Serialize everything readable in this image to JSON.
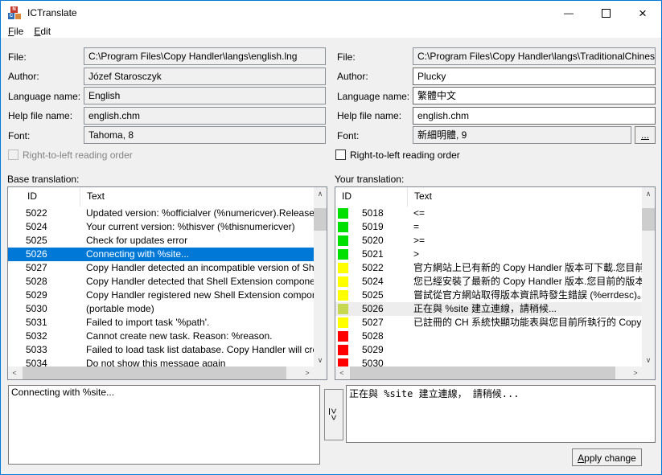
{
  "window": {
    "title": "ICTranslate",
    "icon_letters": [
      "N",
      "C"
    ],
    "controls": {
      "minimize": "—",
      "close": "×"
    }
  },
  "menu": {
    "file": {
      "accel": "F",
      "rest": "ile"
    },
    "edit": {
      "accel": "E",
      "rest": "dit"
    }
  },
  "left_panel": {
    "file_label": "File:",
    "file_value": "C:\\Program Files\\Copy Handler\\langs\\english.lng",
    "author_label": "Author:",
    "author_value": "Józef Starosczyk",
    "language_label": "Language name:",
    "language_value": "English",
    "helpfile_label": "Help file name:",
    "helpfile_value": "english.chm",
    "font_label": "Font:",
    "font_value": "Tahoma, 8",
    "rtl_label": "Right-to-left reading order"
  },
  "right_panel": {
    "file_label": "File:",
    "file_value": "C:\\Program Files\\Copy Handler\\langs\\TraditionalChinese.lng",
    "author_label": "Author:",
    "author_value": "Plucky",
    "language_label": "Language name:",
    "language_value": "繁體中文",
    "helpfile_label": "Help file name:",
    "helpfile_value": "english.chm",
    "font_label": "Font:",
    "font_value": "新細明體, 9",
    "font_button": "...",
    "rtl_label": "Right-to-left reading order"
  },
  "base_list": {
    "label": "Base translation:",
    "columns": [
      "ID",
      "Text"
    ],
    "rows": [
      {
        "id": "5022",
        "text": "Updated version: %officialver (%numericver).Released: %r"
      },
      {
        "id": "5024",
        "text": "Your current version: %thisver (%thisnumericver)"
      },
      {
        "id": "5025",
        "text": "Check for updates error"
      },
      {
        "id": "5026",
        "text": "Connecting with %site...",
        "selected": "active"
      },
      {
        "id": "5027",
        "text": "Copy Handler detected an incompatible version of Shell Exte"
      },
      {
        "id": "5028",
        "text": "Copy Handler detected that Shell Extension component is no"
      },
      {
        "id": "5029",
        "text": "Copy Handler registered new Shell Extension component, bu"
      },
      {
        "id": "5030",
        "text": " (portable mode)"
      },
      {
        "id": "5031",
        "text": "Failed to import task '%path'."
      },
      {
        "id": "5032",
        "text": "Cannot create new task. Reason: %reason."
      },
      {
        "id": "5033",
        "text": "Failed to load task list database. Copy Handler will create a r"
      },
      {
        "id": "5034",
        "text": "Do not show this message again"
      }
    ]
  },
  "your_list": {
    "label": "Your translation:",
    "columns": [
      "ID",
      "Text"
    ],
    "rows": [
      {
        "id": "5018",
        "text": "<=",
        "status_color": "#00e000"
      },
      {
        "id": "5019",
        "text": "=",
        "status_color": "#00e000"
      },
      {
        "id": "5020",
        "text": ">=",
        "status_color": "#00e000"
      },
      {
        "id": "5021",
        "text": ">",
        "status_color": "#00e000"
      },
      {
        "id": "5022",
        "text": "官方網站上已有新的 Copy Handler 版本可下載.您目前的",
        "status_color": "#ffff00"
      },
      {
        "id": "5024",
        "text": "您已經安裝了最新的 Copy Handler 版本.您目前的版本: .",
        "status_color": "#ffff00"
      },
      {
        "id": "5025",
        "text": "嘗試從官方網站取得版本資訊時發生錯誤 (%errdesc)。",
        "status_color": "#ffff00"
      },
      {
        "id": "5026",
        "text": "正在與 %site 建立連線，請稍候...",
        "status_color": "#c6d84f",
        "selected": "inactive"
      },
      {
        "id": "5027",
        "text": "已註冊的 CH 系統快顯功能表與您目前所執行的 Copy Ha",
        "status_color": "#ffff00"
      },
      {
        "id": "5028",
        "text": "",
        "status_color": "#ff0000"
      },
      {
        "id": "5029",
        "text": "",
        "status_color": "#ff0000"
      },
      {
        "id": "5030",
        "text": "",
        "status_color": "#ff0000"
      }
    ]
  },
  "editor": {
    "base_text": "Connecting with %site...",
    "your_text": "正在與 %site 建立連線， 請稍候...",
    "copy_accel": ">",
    "copy_rest": ">",
    "apply_accel": "A",
    "apply_rest": "pply change"
  },
  "icons": {
    "scroll_up": "∧",
    "scroll_down": "∨",
    "scroll_left": "<",
    "scroll_right": ">"
  },
  "colors": {
    "window_border": "#0078d7",
    "selection_active": "#0078d7",
    "selection_inactive": "#ededed",
    "status_ok": "#00e000",
    "status_warning": "#ffff00",
    "status_current": "#c6d84f",
    "status_missing": "#ff0000"
  }
}
